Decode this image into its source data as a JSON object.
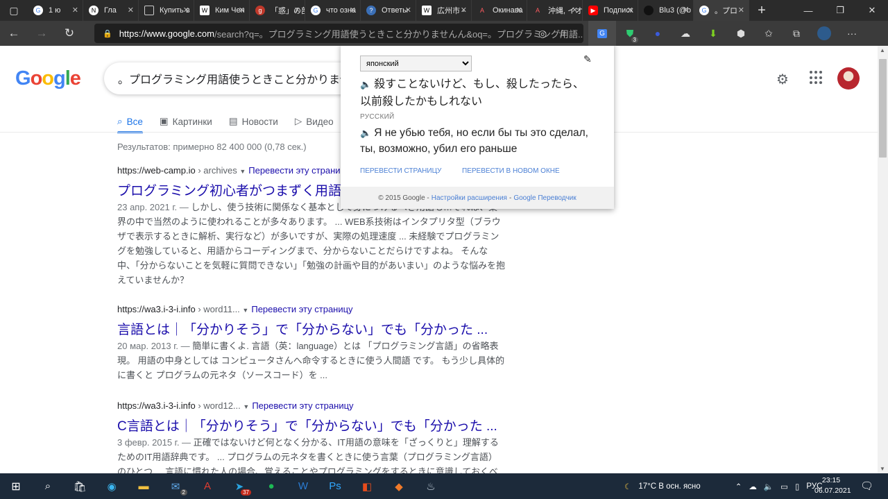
{
  "browser": {
    "tabs": [
      {
        "label": "1 ю",
        "icon": "google-icon"
      },
      {
        "label": "Гла",
        "icon": "notion-icon"
      },
      {
        "label": "Купить в",
        "icon": "page-icon"
      },
      {
        "label": "Ким Чен",
        "icon": "wiki-icon"
      },
      {
        "label": "「惑」の部",
        "icon": "goo-icon"
      },
      {
        "label": "что озна",
        "icon": "google-icon"
      },
      {
        "label": "Ответы",
        "icon": "answers-icon"
      },
      {
        "label": "広州市 -",
        "icon": "wiki-icon"
      },
      {
        "label": "Окинава",
        "icon": "airbnb-icon"
      },
      {
        "label": "沖縄, イオ",
        "icon": "airbnb-icon"
      },
      {
        "label": "Подписк",
        "icon": "youtube-icon"
      },
      {
        "label": "Blu3 (@b",
        "icon": "blu3-icon"
      },
      {
        "label": "。プロ",
        "icon": "google-icon"
      }
    ],
    "url_host": "https://www.google.com",
    "url_rest": "/search?q=。プログラミング用語使うときこと分かりませんん&oq=。プログラミング用語..."
  },
  "google": {
    "logo": "Google",
    "query": "。プログラミング用語使うときこと分かりません",
    "tabs": [
      {
        "label": "Все",
        "icon": "search-icon"
      },
      {
        "label": "Картинки",
        "icon": "image-icon"
      },
      {
        "label": "Новости",
        "icon": "news-icon"
      },
      {
        "label": "Видео",
        "icon": "video-icon"
      }
    ],
    "stats": "Результатов: примерно 82 400 000 (0,78 сек.)",
    "results": [
      {
        "url": "https://web-camp.io",
        "crumb": "› archives",
        "translate": "Перевести эту страниц",
        "title": "プログラミング初心者がつまずく用語を",
        "date": "23 апр. 2021 г. — ",
        "snippet": "しかし、使う技術に関係なく基本として身につけるべき用語も…それは、業界の中で当然のように使われることが多々あります。 ... WEB系技術はインタプリタ型（ブラウザで表示するときに解析、実行など）が多いですが、実際の処理速度 ... 未経験でプログラミングを勉強していると、用語からコーディングまで、分からないことだらけですよね。 そんな中、「分からないことを気軽に質問できない」「勉強の計画や目的があいまい」のような悩みを抱えていませんか？"
      },
      {
        "url": "https://wa3.i-3-i.info",
        "crumb": "› word11...",
        "translate": "Перевести эту страницу",
        "title": "言語とは｜「分かりそう」で「分からない」でも「分かった ...",
        "date": "20 мар. 2013 г. — ",
        "snippet": "簡単に書くよ. 言語（英：language）とは 「プログラミング言語」の省略表現。 用語の中身としては コンピュータさんへ命令するときに使う人間語 です。 もう少し具体的に書くと プログラムの元ネタ（ソースコード）を ..."
      },
      {
        "url": "https://wa3.i-3-i.info",
        "crumb": "› word12...",
        "translate": "Перевести эту страницу",
        "title": "C言語とは｜「分かりそう」で「分からない」でも「分かった ...",
        "date": "3 февр. 2015 г. — ",
        "snippet": "正確ではないけど何となく分かる、IT用語の意味を「ざっくりと」理解するためのIT用語辞典です。 ... プログラムの元ネタを書くときに使う言葉（プログラミング言語）のひとつ ... 言語に慣れた人の場合、覚えることやプログラミングをするときに意識しておくべ"
      }
    ]
  },
  "translate_popup": {
    "source_language": "японский",
    "source_text": "殺すことないけど、もし、殺したったら、以前殺したかもしれない",
    "target_language": "РУССКИЙ",
    "target_text": "Я не убью тебя, но если бы ты это сделал, ты, возможно, убил его раньше",
    "link_translate_page": "ПЕРЕВЕСТИ СТРАНИЦУ",
    "link_new_window": "ПЕРЕВЕСТИ В НОВОМ ОКНЕ",
    "footer_copyright": "© 2015 Google -",
    "footer_settings": "Настройки расширения",
    "footer_sep": "-",
    "footer_gt": "Google Переводчик"
  },
  "taskbar": {
    "weather": "17°C  В осн. ясно",
    "lang": "РУС",
    "time": "23:15",
    "date": "06.07.2021",
    "mail_badge": "2",
    "telegram_badge": "37",
    "ext_badge": "3"
  },
  "colors": {
    "link": "#1a0dab",
    "accent": "#1a73e8",
    "taskbar": "#1c2a3a"
  }
}
